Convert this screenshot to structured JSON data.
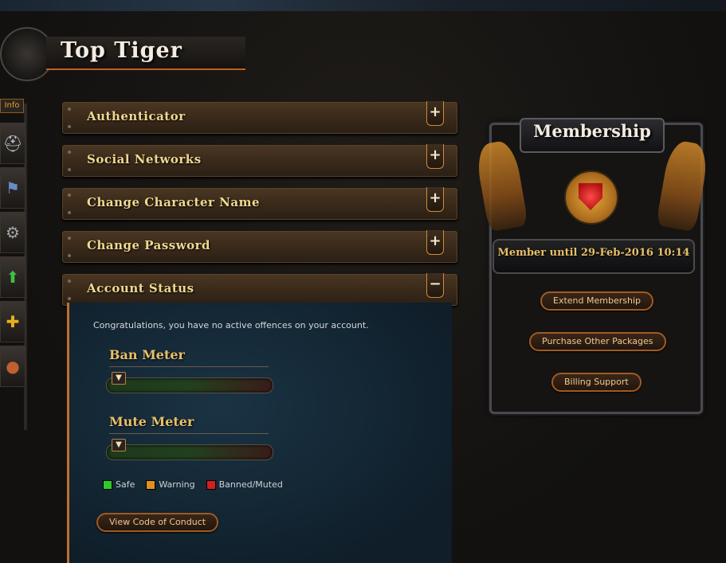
{
  "header": {
    "title": "Top Tiger"
  },
  "sidebar": {
    "tab_label": "Info",
    "items": [
      {
        "icon": "helmet-icon",
        "glyph": "⛑"
      },
      {
        "icon": "banner-icon",
        "glyph": "⚑"
      },
      {
        "icon": "gear-icon",
        "glyph": "⚙"
      },
      {
        "icon": "upgrade-arrow-icon",
        "glyph": "⬆"
      },
      {
        "icon": "add-friend-icon",
        "glyph": "✚"
      },
      {
        "icon": "mouse-icon",
        "glyph": "●"
      }
    ]
  },
  "sections": [
    {
      "label": "Authenticator",
      "toggle": "+"
    },
    {
      "label": "Social Networks",
      "toggle": "+"
    },
    {
      "label": "Change Character Name",
      "toggle": "+"
    },
    {
      "label": "Change Password",
      "toggle": "+"
    },
    {
      "label": "Account Status",
      "toggle": "−"
    }
  ],
  "account_status": {
    "message": "Congratulations, you have no active offences on your account.",
    "ban_meter": {
      "title": "Ban Meter",
      "level": 0.0
    },
    "mute_meter": {
      "title": "Mute Meter",
      "level": 0.0
    },
    "legend": {
      "safe": "Safe",
      "warning": "Warning",
      "banned": "Banned/Muted"
    },
    "code_of_conduct_button": "View Code of Conduct"
  },
  "membership": {
    "title": "Membership",
    "until": "Member until 29-Feb-2016 10:14",
    "extend_button": "Extend Membership",
    "purchase_button": "Purchase Other Packages",
    "billing_button": "Billing Support"
  },
  "colors": {
    "accent": "#c0702a",
    "safe": "#2ec82e",
    "warning": "#e0901a",
    "banned": "#d02020",
    "gold_text": "#f0d890"
  }
}
